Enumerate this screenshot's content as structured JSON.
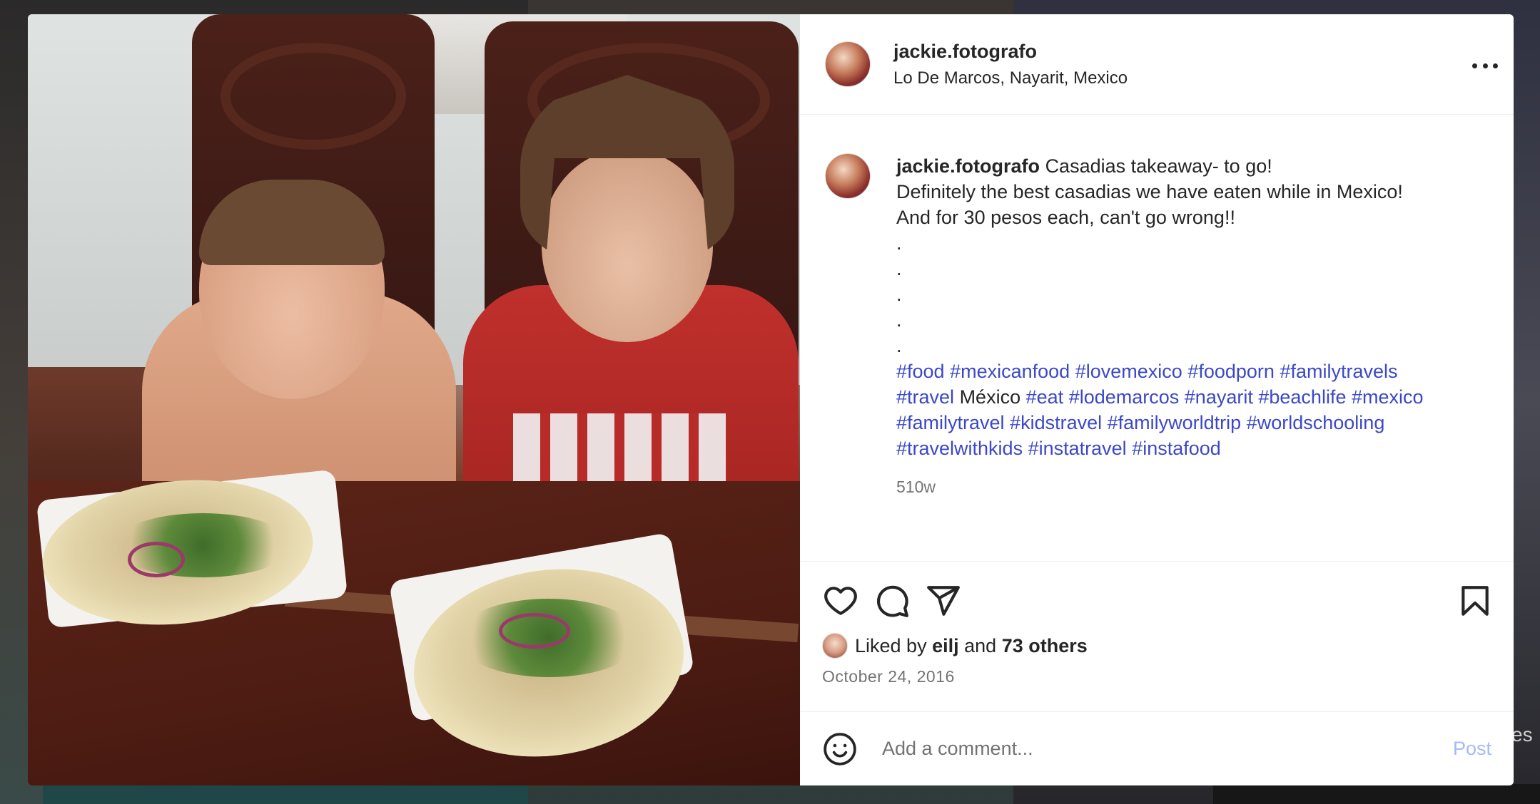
{
  "post": {
    "username": "jackie.fotografo",
    "location": "Lo De Marcos, Nayarit, Mexico",
    "more_options_icon": "more-horizontal-icon"
  },
  "caption": {
    "username": "jackie.fotografo",
    "line1": "Casadias takeaway- to go!",
    "line2": "Definitely the best casadias we have eaten while in Mexico!",
    "line3": "And for 30 pesos each, can't go wrong!!",
    "dots": [
      ".",
      ".",
      ".",
      ".",
      "."
    ],
    "hashtags_line1": [
      "#food",
      "#mexicanfood",
      "#lovemexico",
      "#foodporn",
      "#familytravels"
    ],
    "line_travel_tag": "#travel",
    "line_travel_word": "México",
    "hashtags_line2": [
      "#eat",
      "#lodemarcos",
      "#nayarit",
      "#beachlife",
      "#mexico"
    ],
    "hashtags_line3": [
      "#familytravel",
      "#kidstravel",
      "#familyworldtrip",
      "#worldschooling"
    ],
    "hashtags_line4": [
      "#travelwithkids",
      "#instatravel",
      "#instafood"
    ],
    "time_ago": "510w"
  },
  "actions": {
    "like_icon": "heart-icon",
    "comment_icon": "comment-icon",
    "share_icon": "share-icon",
    "save_icon": "bookmark-icon"
  },
  "likes": {
    "prefix": "Liked by",
    "user": "eilj",
    "connector": "and",
    "others": "73 others"
  },
  "date": "October 24, 2016",
  "comment": {
    "placeholder": "Add a comment...",
    "post_label": "Post",
    "emoji_icon": "emoji-icon"
  },
  "background": {
    "edge_text": "es"
  },
  "colors": {
    "hashtag": "#3b48c8",
    "post_button": "#a7b9f5",
    "muted_text": "#737373"
  }
}
